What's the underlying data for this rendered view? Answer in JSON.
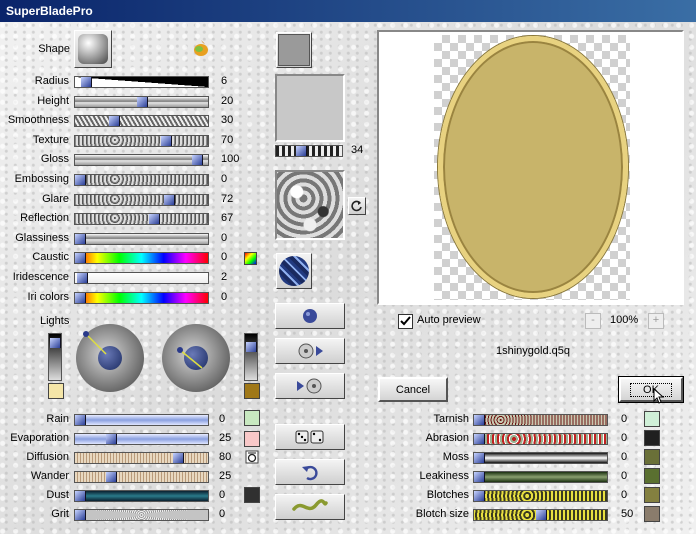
{
  "window": {
    "title": "SuperBladePro"
  },
  "shape_label": "Shape",
  "left_sliders": [
    {
      "label": "Radius",
      "value": "6",
      "frac": 0.05,
      "style": "wedge"
    },
    {
      "label": "Height",
      "value": "20",
      "frac": 0.5,
      "style": "metal"
    },
    {
      "label": "Smoothness",
      "value": "30",
      "frac": 0.28,
      "style": "stripe"
    },
    {
      "label": "Texture",
      "value": "70",
      "frac": 0.7,
      "style": "rough"
    },
    {
      "label": "Gloss",
      "value": "100",
      "frac": 0.95,
      "style": "metal"
    },
    {
      "label": "Embossing",
      "value": "0",
      "frac": 0.0,
      "style": "rough"
    },
    {
      "label": "Glare",
      "value": "72",
      "frac": 0.72,
      "style": "rough"
    },
    {
      "label": "Reflection",
      "value": "67",
      "frac": 0.6,
      "style": "rough"
    },
    {
      "label": "Glassiness",
      "value": "0",
      "frac": 0.0,
      "style": "metal"
    },
    {
      "label": "Caustic",
      "value": "0",
      "frac": 0.0,
      "style": "rainbow"
    },
    {
      "label": "Iridescence",
      "value": "2",
      "frac": 0.02,
      "style": "white"
    },
    {
      "label": "Iri colors",
      "value": "0",
      "frac": 0.0,
      "style": "rainbow"
    }
  ],
  "lights_label": "Lights",
  "texture_scale_value": "34",
  "bottom_sliders": [
    {
      "label": "Rain",
      "value": "0",
      "frac": 0.0,
      "style": "blue"
    },
    {
      "label": "Evaporation",
      "value": "25",
      "frac": 0.25,
      "style": "blue"
    },
    {
      "label": "Diffusion",
      "value": "80",
      "frac": 0.8,
      "style": "tan"
    },
    {
      "label": "Wander",
      "value": "25",
      "frac": 0.25,
      "style": "tan"
    },
    {
      "label": "Dust",
      "value": "0",
      "frac": 0.0,
      "style": "teal"
    },
    {
      "label": "Grit",
      "value": "0",
      "frac": 0.0,
      "style": "grit"
    }
  ],
  "right_sliders": [
    {
      "label": "Tarnish",
      "value": "0",
      "frac": 0.0,
      "style": "red"
    },
    {
      "label": "Abrasion",
      "value": "0",
      "frac": 0.0,
      "style": "redgreen"
    },
    {
      "label": "Moss",
      "value": "0",
      "frac": 0.0,
      "style": "dark"
    },
    {
      "label": "Leakiness",
      "value": "0",
      "frac": 0.0,
      "style": "darkgreen"
    },
    {
      "label": "Blotches",
      "value": "0",
      "frac": 0.0,
      "style": "yellow"
    },
    {
      "label": "Blotch size",
      "value": "50",
      "frac": 0.5,
      "style": "yellow"
    }
  ],
  "auto_preview": {
    "label": "Auto preview",
    "checked": true
  },
  "zoom": {
    "minus": "-",
    "value": "100%",
    "plus": "+"
  },
  "preset_name": "1shinygold.q5q",
  "cancel_label": "Cancel",
  "ok_label": "OK",
  "colors": {
    "gold": "#c8b46a",
    "rain_swatch": "#c8e8c0",
    "evap_swatch": "#f8c8c8",
    "dust_swatch": "#303030",
    "tarnish_swatch": "#d0f0d8",
    "abrasion_swatch": "#202020",
    "moss_swatch": "#6a7038",
    "leak_swatch": "#5a7030",
    "blotch_swatch": "#848040",
    "blotchsize_swatch": "#8a7c6c",
    "light1_swatch": "#f5e6a8",
    "light2_swatch": "#a07818"
  },
  "icons": [
    "gem-icon",
    "refresh-icon",
    "sphere-icon",
    "cd-forward-icon",
    "cd-back-icon",
    "dice-icon",
    "undo-icon",
    "squiggle-icon",
    "checkmark-icon",
    "cursor-icon"
  ]
}
